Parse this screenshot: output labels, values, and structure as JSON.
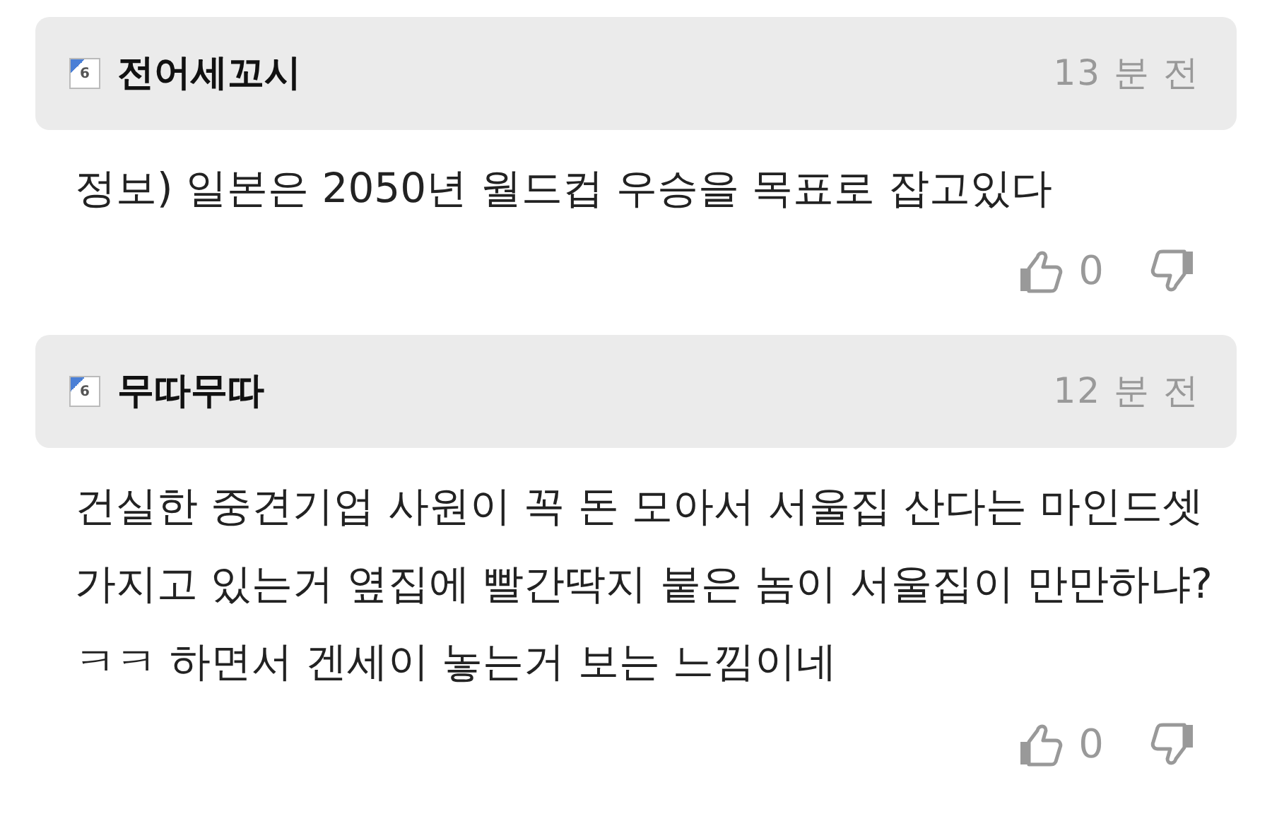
{
  "comments": [
    {
      "level": "6",
      "author": "전어세꼬시",
      "time": "13 분 전",
      "text": "정보) 일본은 2050년 월드컵 우승을 목표로 잡고있다",
      "likes": "0"
    },
    {
      "level": "6",
      "author": "무따무따",
      "time": "12 분 전",
      "text": "건실한 중견기업 사원이 꼭 돈 모아서 서울집 산다는 마인드셋 가지고 있는거 옆집에 빨간딱지 붙은 놈이 서울집이 만만하냐?ㅋㅋ 하면서 겐세이 놓는거 보는 느낌이네",
      "likes": "0"
    }
  ]
}
